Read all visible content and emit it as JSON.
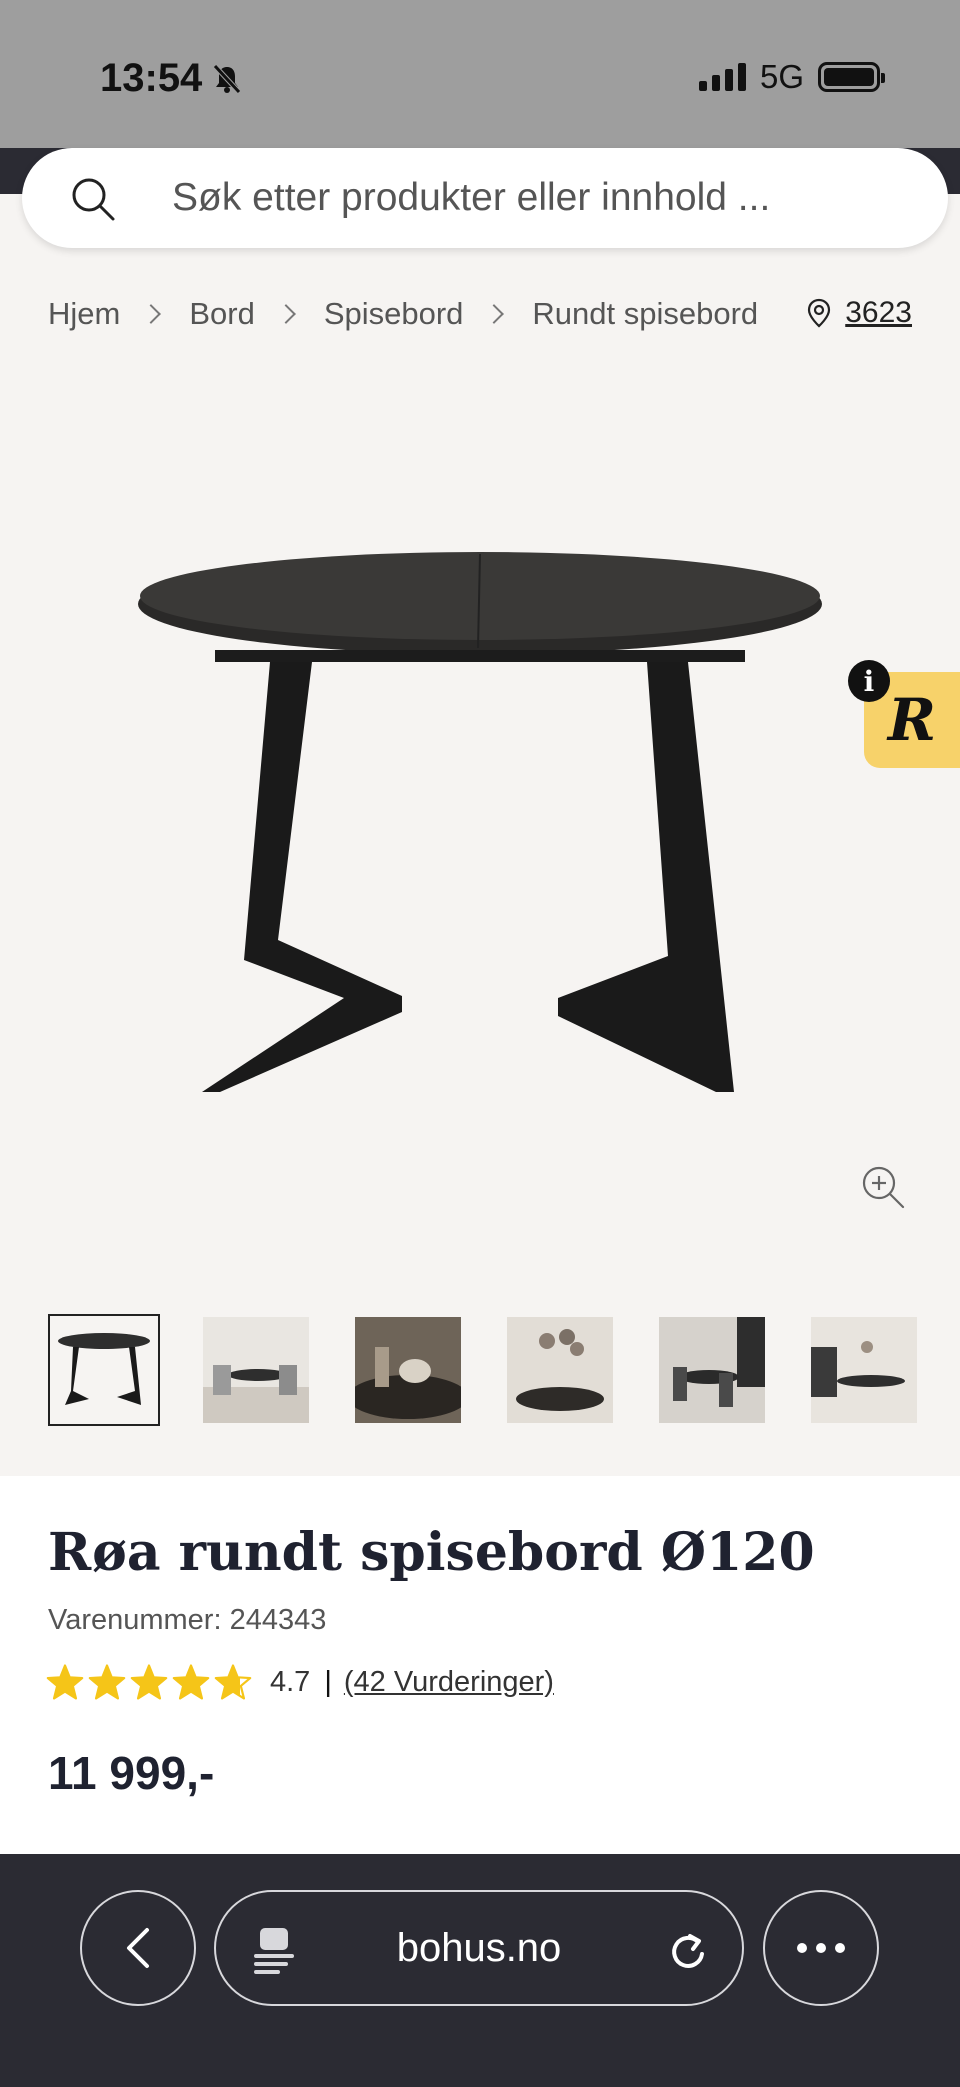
{
  "status": {
    "time": "13:54",
    "network": "5G"
  },
  "search": {
    "placeholder": "Søk etter produkter eller innhold ..."
  },
  "breadcrumb": [
    "Hjem",
    "Bord",
    "Spisebord",
    "Rundt spisebord"
  ],
  "store": {
    "number": "3623"
  },
  "product": {
    "title": "Røa rundt spisebord Ø120",
    "sku": "Varenummer: 244343",
    "rating_value": "4.7",
    "rating_stars": 4.7,
    "rating_count": "(42 Vurderinger)",
    "price": "11 999,-"
  },
  "thumbnails": 6,
  "browser": {
    "url": "bohus.no"
  },
  "colors": {
    "accent_badge": "#f7d26a",
    "star": "#f5c518",
    "browser_bg": "#2b2b33"
  }
}
